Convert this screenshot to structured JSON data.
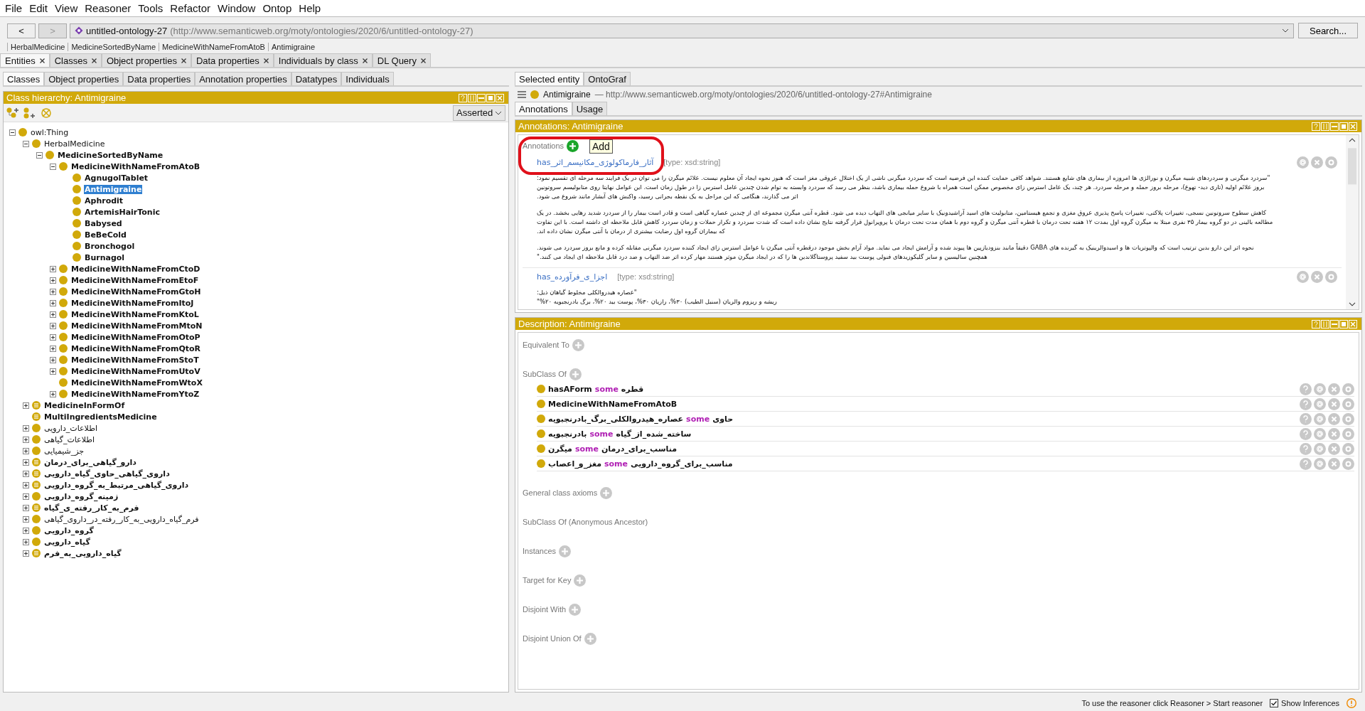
{
  "menu": [
    "File",
    "Edit",
    "View",
    "Reasoner",
    "Tools",
    "Refactor",
    "Window",
    "Ontop",
    "Help"
  ],
  "nav": {
    "back": "<",
    "forward": ">"
  },
  "ontology": {
    "name": "untitled-ontology-27",
    "iri": "(http://www.semanticweb.org/moty/ontologies/2020/6/untitled-ontology-27)"
  },
  "search_button": "Search...",
  "breadcrumb": [
    "HerbalMedicine",
    "MedicineSortedByName",
    "MedicineWithNameFromAtoB",
    "Antimigraine"
  ],
  "workspace_tabs": [
    {
      "label": "Entities",
      "selected": true
    },
    {
      "label": "Classes",
      "selected": false
    },
    {
      "label": "Object properties",
      "selected": false
    },
    {
      "label": "Data properties",
      "selected": false
    },
    {
      "label": "Individuals by class",
      "selected": false
    },
    {
      "label": "DL Query",
      "selected": false
    }
  ],
  "left_tabs": [
    {
      "label": "Classes",
      "selected": true
    },
    {
      "label": "Object properties",
      "selected": false
    },
    {
      "label": "Data properties",
      "selected": false
    },
    {
      "label": "Annotation properties",
      "selected": false
    },
    {
      "label": "Datatypes",
      "selected": false
    },
    {
      "label": "Individuals",
      "selected": false
    }
  ],
  "class_hierarchy": {
    "title": "Class hierarchy: Antimigraine",
    "mode": "Asserted",
    "tree": [
      {
        "label": "owl:Thing",
        "kind": "class",
        "bold": false,
        "selected": false,
        "expanded": true,
        "children": [
          {
            "label": "HerbalMedicine",
            "kind": "class",
            "bold": false,
            "selected": false,
            "expanded": true,
            "children": [
              {
                "label": "MedicineSortedByName",
                "kind": "class",
                "bold": true,
                "selected": false,
                "expanded": true,
                "children": [
                  {
                    "label": "MedicineWithNameFromAtoB",
                    "kind": "class",
                    "bold": true,
                    "selected": false,
                    "expanded": true,
                    "children": [
                      {
                        "label": "AgnugolTablet",
                        "kind": "class",
                        "bold": true,
                        "selected": false
                      },
                      {
                        "label": "Antimigraine",
                        "kind": "class",
                        "bold": true,
                        "selected": true
                      },
                      {
                        "label": "Aphrodit",
                        "kind": "class",
                        "bold": true,
                        "selected": false
                      },
                      {
                        "label": "ArtemisHairTonic",
                        "kind": "class",
                        "bold": true,
                        "selected": false
                      },
                      {
                        "label": "Babysed",
                        "kind": "class",
                        "bold": true,
                        "selected": false
                      },
                      {
                        "label": "BeBeCold",
                        "kind": "class",
                        "bold": true,
                        "selected": false
                      },
                      {
                        "label": "Bronchogol",
                        "kind": "class",
                        "bold": true,
                        "selected": false
                      },
                      {
                        "label": "Burnagol",
                        "kind": "class",
                        "bold": true,
                        "selected": false
                      }
                    ]
                  },
                  {
                    "label": "MedicineWithNameFromCtoD",
                    "kind": "class",
                    "bold": true,
                    "selected": false,
                    "expanded": false
                  },
                  {
                    "label": "MedicineWithNameFromEtoF",
                    "kind": "class",
                    "bold": true,
                    "selected": false,
                    "expanded": false
                  },
                  {
                    "label": "MedicineWithNameFromGtoH",
                    "kind": "class",
                    "bold": true,
                    "selected": false,
                    "expanded": false
                  },
                  {
                    "label": "MedicineWithNameFromItoJ",
                    "kind": "class",
                    "bold": true,
                    "selected": false,
                    "expanded": false
                  },
                  {
                    "label": "MedicineWithNameFromKtoL",
                    "kind": "class",
                    "bold": true,
                    "selected": false,
                    "expanded": false
                  },
                  {
                    "label": "MedicineWithNameFromMtoN",
                    "kind": "class",
                    "bold": true,
                    "selected": false,
                    "expanded": false
                  },
                  {
                    "label": "MedicineWithNameFromOtoP",
                    "kind": "class",
                    "bold": true,
                    "selected": false,
                    "expanded": false
                  },
                  {
                    "label": "MedicineWithNameFromQtoR",
                    "kind": "class",
                    "bold": true,
                    "selected": false,
                    "expanded": false
                  },
                  {
                    "label": "MedicineWithNameFromStoT",
                    "kind": "class",
                    "bold": true,
                    "selected": false,
                    "expanded": false
                  },
                  {
                    "label": "MedicineWithNameFromUtoV",
                    "kind": "class",
                    "bold": true,
                    "selected": false,
                    "expanded": false
                  },
                  {
                    "label": "MedicineWithNameFromWtoX",
                    "kind": "class",
                    "bold": true,
                    "selected": false
                  },
                  {
                    "label": "MedicineWithNameFromYtoZ",
                    "kind": "class",
                    "bold": true,
                    "selected": false,
                    "expanded": false
                  }
                ]
              }
            ]
          },
          {
            "label": "MedicineInFormOf",
            "kind": "defined",
            "bold": true,
            "selected": false,
            "expanded": false
          },
          {
            "label": "MultiIngredientsMedicine",
            "kind": "defined",
            "bold": true,
            "selected": false
          },
          {
            "label": "اطلاعات_دارویی",
            "kind": "class",
            "bold": false,
            "selected": false,
            "expanded": false
          },
          {
            "label": "اطلاعات_گیاهی",
            "kind": "class",
            "bold": false,
            "selected": false,
            "expanded": false
          },
          {
            "label": "جز_شیمیایی",
            "kind": "class",
            "bold": false,
            "selected": false,
            "expanded": false
          },
          {
            "label": "دارو_گیاهی_برای_درمان",
            "kind": "defined",
            "bold": true,
            "selected": false,
            "expanded": false
          },
          {
            "label": "داروی_گیاهی_حاوی_گیاه_دارویی",
            "kind": "defined",
            "bold": true,
            "selected": false,
            "expanded": false
          },
          {
            "label": "داروی_گیاهی_مرتبط_به_گروه_دارویی",
            "kind": "defined",
            "bold": true,
            "selected": false,
            "expanded": false
          },
          {
            "label": "زمینه_گروه_دارویی",
            "kind": "class",
            "bold": true,
            "selected": false,
            "expanded": false
          },
          {
            "label": "فرم_به_کار_رفته_ی_گیاه",
            "kind": "defined",
            "bold": true,
            "selected": false,
            "expanded": false
          },
          {
            "label": "فرم_گیاه_دارویی_به_کار_رفته_در_داروی_گیاهی",
            "kind": "class",
            "bold": false,
            "selected": false,
            "expanded": false
          },
          {
            "label": "گروه_دارویی",
            "kind": "class",
            "bold": true,
            "selected": false,
            "expanded": false
          },
          {
            "label": "گیاه_دارویی",
            "kind": "class",
            "bold": true,
            "selected": false,
            "expanded": false
          },
          {
            "label": "گیاه_دارویی_به_فرم",
            "kind": "defined",
            "bold": true,
            "selected": false,
            "expanded": false
          }
        ]
      }
    ]
  },
  "right_tabs": [
    {
      "label": "Selected entity",
      "selected": true
    },
    {
      "label": "OntoGraf",
      "selected": false
    }
  ],
  "entity": {
    "name": "Antimigraine",
    "iri": "— http://www.semanticweb.org/moty/ontologies/2020/6/untitled-ontology-27#Antimigraine"
  },
  "entity_tabs": [
    {
      "label": "Annotations",
      "selected": true
    },
    {
      "label": "Usage",
      "selected": false
    }
  ],
  "annotations": {
    "title": "Annotations: Antimigraine",
    "label": "Annotations",
    "tooltip": "Add",
    "items": [
      {
        "property": "has_آثار_فارماکولوژی_مکانیسم_اثر",
        "type": "[type: xsd:string]",
        "paragraphs": [
          [
            "\"سردرد میگرنی و سردردهای شبیه میگرن و نورالژی ها امروزه از بیماری های شایع هستند. شواهد کافی حمایت کننده این فرضیه است که سردرد میگرنی ناشی از یک اختلال عروقی مغز است که هنوز نحوه ایجاد آن معلوم نیست. علائم میگرن را می توان در یک فرآیند سه مرحله ای تقسیم نمود:",
            "بروز علائم اولیه (تاری دید- تهوع)، مرحله بروز حمله و مرحله سردرد. هر چند، یک عامل استرس زای مخصوص ممکن است همراه با شروع حمله بیماری باشد، بنظر می رسد که سردرد وابسته به توام شدن چندین عامل استرس زا در طول زمان است. این عوامل نهایتا روی متابولیسم سروتونین",
            "اثر می گذارند، هنگامی که این مراحل به یک نقطه بحرانی رسید، واکنش های آبشار مانند شروع می شود."
          ],
          [
            "کاهش سطوح سروتونین نسجی، تغییرات پلاکتی، تغییرات پاسخ پذیری عروق مغزی و تجمع هیستامین، متابولیت های اسید آراشیدونیک با سایر میانجی های التهاب دیده می شود. قطره آنتی میگرن مجموعه ای از چندین عصاره گیاهی است و قادر است بیمار را از سردرد شدید رهایی بخشد. در یک",
            "مطالعه بالینی در دو گروه بیمار ۳۵ نفری مبتلا به میگرن گروه اول بمدت ۱۲ هفته تحت درمان با قطره آنتی میگرن و گروه دوم با همان مدت تحت درمان با پروپرانول قرار گرفته نتایج نشان داده است که شدت سردرد و تکرار حملات و زمان سردرد کاهش قابل ملاحظه ای داشته است. با این تفاوت",
            "که بیماران گروه اول رضایت بیشتری از درمان با آنتی میگرن نشان داده اند."
          ],
          [
            "نحوه اثر این دارو بدین ترتیب است که والپوتریات ها و اسیدوالرینیک به گیرنده های GABA دقیقاً مانند بنزودیازپین ها پیوند شده و آرامش ایجاد می نماید. مواد آرام بخش موجود درقطره آنتی میگرن با عوامل استرس زای ایجاد کننده سردرد میگرنی مقابله کرده و مانع بروز سردرد می شوند.",
            "همچنین سالیسین و سایر گلیکوزیدهای فنولی پوست بید سفید پروستاگلاندین ها را که در ایجاد میگرن موثر هستند مهار کرده اثر ضد التهاب و ضد درد قابل ملاحظه ای ایجاد می کنند.\""
          ]
        ]
      },
      {
        "property": "has_اجزا_ی_فرآورده",
        "type": "[type: xsd:string]",
        "paragraphs": [
          [
            "\"عصاره هیدروالکلی مخلوط گیاهان ذیل:",
            "ریشه و ریزوم والریان (سنبل الطیب) ۳۰%، رازیان ۳۰%، پوست بید ۲۰%، برگ بادرنجبویه ۲۰%\""
          ]
        ]
      }
    ]
  },
  "description": {
    "title": "Description: Antimigraine",
    "sections": [
      {
        "label": "Equivalent To",
        "addable": true
      },
      {
        "label": "SubClass Of",
        "addable": true,
        "rows": [
          {
            "kind": "restriction",
            "left": "hasAForm",
            "keyword": "some",
            "right": "قطره"
          },
          {
            "kind": "class",
            "left": "MedicineWithNameFromAtoB"
          },
          {
            "kind": "restriction",
            "left": "عصاره_هیدروالکلی_برگ_بادرنجبویه",
            "keyword": "some",
            "right": "حاوی"
          },
          {
            "kind": "restriction",
            "left": "بادرنجبویه",
            "keyword": "some",
            "right": "ساخته_شده_از_گیاه"
          },
          {
            "kind": "restriction",
            "left": "میگرن",
            "keyword": "some",
            "right": "مناسب_برای_درمان"
          },
          {
            "kind": "restriction",
            "left": "مغز_و_اعصاب",
            "keyword": "some",
            "right": "مناسب_برای_گروه_دارویی"
          }
        ]
      },
      {
        "label": "General class axioms",
        "addable": true
      },
      {
        "label": "SubClass Of (Anonymous Ancestor)",
        "addable": false
      },
      {
        "label": "Instances",
        "addable": true
      },
      {
        "label": "Target for Key",
        "addable": true
      },
      {
        "label": "Disjoint With",
        "addable": true
      },
      {
        "label": "Disjoint Union Of",
        "addable": true
      }
    ]
  },
  "status_bar": {
    "message": "To use the reasoner click Reasoner > Start reasoner",
    "show_inferences": {
      "label": "Show Inferences",
      "checked": true
    }
  }
}
